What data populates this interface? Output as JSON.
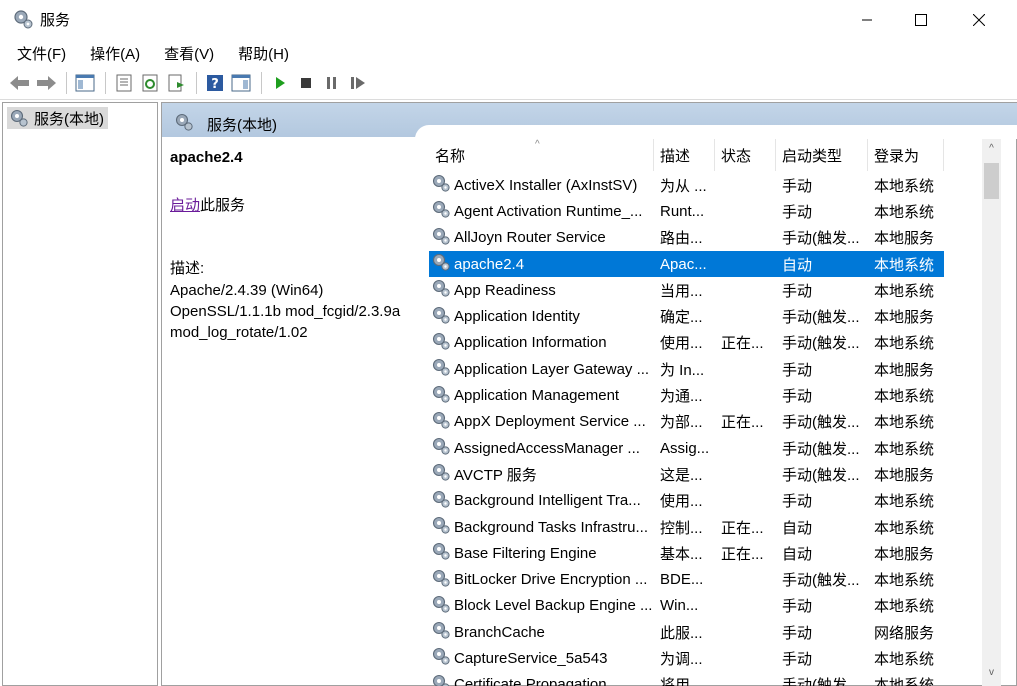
{
  "window": {
    "title": "服务"
  },
  "menu": [
    "文件(F)",
    "操作(A)",
    "查看(V)",
    "帮助(H)"
  ],
  "toolbar": {
    "buttons": [
      "back-icon",
      "forward-icon",
      "show-hide-tree-icon",
      "properties-icon",
      "refresh-icon",
      "export-list-icon",
      "help-icon",
      "show-hide-action-pane-icon",
      "start-service-icon",
      "stop-service-icon",
      "pause-service-icon",
      "restart-service-icon"
    ]
  },
  "tree": {
    "root_label": "服务(本地)"
  },
  "pane": {
    "header": "服务(本地)"
  },
  "details": {
    "service_name": "apache2.4",
    "start_link": "启动",
    "start_suffix": "此服务",
    "desc_label": "描述:",
    "desc_lines": [
      "Apache/2.4.39 (Win64)",
      "OpenSSL/1.1.1b mod_fcgid/2.3.9a",
      "mod_log_rotate/1.02"
    ]
  },
  "list": {
    "columns": [
      "名称",
      "描述",
      "状态",
      "启动类型",
      "登录为"
    ],
    "sort_arrow": "^",
    "rows": [
      {
        "name": "ActiveX Installer (AxInstSV)",
        "desc": "为从 ...",
        "status": "",
        "start": "手动",
        "logon": "本地系统"
      },
      {
        "name": "Agent Activation Runtime_...",
        "desc": "Runt...",
        "status": "",
        "start": "手动",
        "logon": "本地系统"
      },
      {
        "name": "AllJoyn Router Service",
        "desc": "路由...",
        "status": "",
        "start": "手动(触发...",
        "logon": "本地服务"
      },
      {
        "name": "apache2.4",
        "desc": "Apac...",
        "status": "",
        "start": "自动",
        "logon": "本地系统",
        "selected": true
      },
      {
        "name": "App Readiness",
        "desc": "当用...",
        "status": "",
        "start": "手动",
        "logon": "本地系统"
      },
      {
        "name": "Application Identity",
        "desc": "确定...",
        "status": "",
        "start": "手动(触发...",
        "logon": "本地服务"
      },
      {
        "name": "Application Information",
        "desc": "使用...",
        "status": "正在...",
        "start": "手动(触发...",
        "logon": "本地系统"
      },
      {
        "name": "Application Layer Gateway ...",
        "desc": "为 In...",
        "status": "",
        "start": "手动",
        "logon": "本地服务"
      },
      {
        "name": "Application Management",
        "desc": "为通...",
        "status": "",
        "start": "手动",
        "logon": "本地系统"
      },
      {
        "name": "AppX Deployment Service ...",
        "desc": "为部...",
        "status": "正在...",
        "start": "手动(触发...",
        "logon": "本地系统"
      },
      {
        "name": "AssignedAccessManager ...",
        "desc": "Assig...",
        "status": "",
        "start": "手动(触发...",
        "logon": "本地系统"
      },
      {
        "name": "AVCTP 服务",
        "desc": "这是...",
        "status": "",
        "start": "手动(触发...",
        "logon": "本地服务"
      },
      {
        "name": "Background Intelligent Tra...",
        "desc": "使用...",
        "status": "",
        "start": "手动",
        "logon": "本地系统"
      },
      {
        "name": "Background Tasks Infrastru...",
        "desc": "控制...",
        "status": "正在...",
        "start": "自动",
        "logon": "本地系统"
      },
      {
        "name": "Base Filtering Engine",
        "desc": "基本...",
        "status": "正在...",
        "start": "自动",
        "logon": "本地服务"
      },
      {
        "name": "BitLocker Drive Encryption ...",
        "desc": "BDE...",
        "status": "",
        "start": "手动(触发...",
        "logon": "本地系统"
      },
      {
        "name": "Block Level Backup Engine ...",
        "desc": "Win...",
        "status": "",
        "start": "手动",
        "logon": "本地系统"
      },
      {
        "name": "BranchCache",
        "desc": "此服...",
        "status": "",
        "start": "手动",
        "logon": "网络服务"
      },
      {
        "name": "CaptureService_5a543",
        "desc": "为调...",
        "status": "",
        "start": "手动",
        "logon": "本地系统"
      },
      {
        "name": "Certificate Propagation",
        "desc": "将用...",
        "status": "",
        "start": "手动(触发...",
        "logon": "本地系统"
      }
    ]
  },
  "scrollbar": {
    "up": "^",
    "down": "v"
  },
  "colors": {
    "selection": "#0078d7",
    "header_band": "#bcd0e5",
    "link": "#6a1b9a"
  }
}
